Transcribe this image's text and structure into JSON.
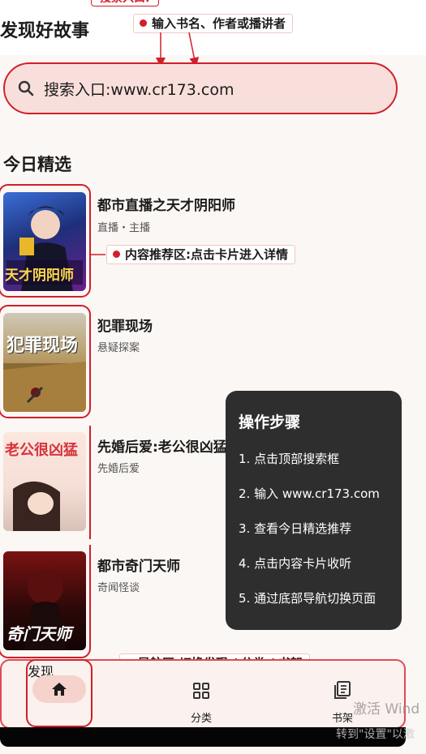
{
  "header": {
    "top_tag": "搜索入口:",
    "title": "发现好故事",
    "search_callout": "输入书名、作者或播讲者"
  },
  "search": {
    "text": "搜索入口:www.cr173.com"
  },
  "section": {
    "title": "今日精选"
  },
  "books": [
    {
      "title": "都市直播之天才阴阳师",
      "tag": "直播・主播",
      "cover_text": "天才阴阳师"
    },
    {
      "title": "犯罪现场",
      "tag": "悬疑探案",
      "cover_text": "犯罪现场"
    },
    {
      "title": "先婚后爱:老公很凶猛",
      "tag": "先婚后爱",
      "cover_text": "老公很凶猛"
    },
    {
      "title": "都市奇门天师",
      "tag": "奇闻怪谈",
      "cover_text": "奇门天师"
    }
  ],
  "content_callout": "内容推荐区:点击卡片进入详情",
  "steps": {
    "title": "操作步骤",
    "items": [
      "1. 点击顶部搜索框",
      "2. 输入 www.cr173.com",
      "3. 查看今日精选推荐",
      "4. 点击内容卡片收听",
      "5. 通过底部导航切换页面"
    ]
  },
  "nav_callout": "导航区:切换发现 / 分类 / 书架",
  "nav": {
    "items": [
      {
        "label": "发现",
        "icon": "home-icon",
        "active": true
      },
      {
        "label": "分类",
        "icon": "grid-icon",
        "active": false
      },
      {
        "label": "书架",
        "icon": "bookshelf-icon",
        "active": false
      }
    ]
  },
  "watermark": {
    "line1": "激活 Wind",
    "line2": "转到\"设置\"以激"
  },
  "colors": {
    "accent": "#d11f2a",
    "search_bg": "#f9dfdb",
    "steps_bg": "#2e2e2e",
    "page_bg": "#fbf7f4"
  }
}
